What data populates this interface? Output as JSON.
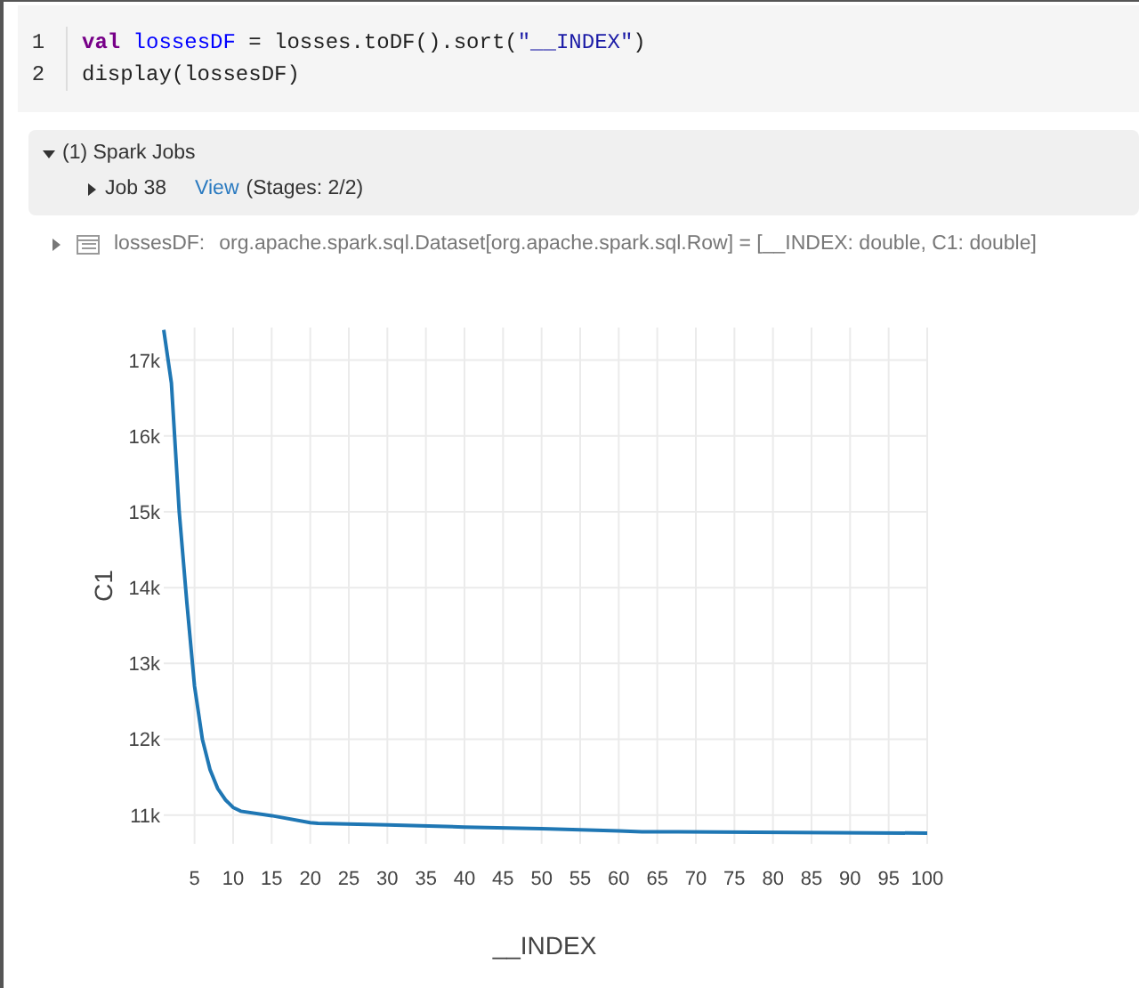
{
  "code_cell": {
    "lines": [
      {
        "number": "1",
        "tokens": [
          {
            "kind": "keyword",
            "text": "val"
          },
          {
            "kind": "variable",
            "text": " lossesDF"
          },
          {
            "kind": "plain",
            "text": " = losses.toDF().sort("
          },
          {
            "kind": "string",
            "text": "\"__INDEX\""
          },
          {
            "kind": "plain",
            "text": ")"
          }
        ]
      },
      {
        "number": "2",
        "tokens": [
          {
            "kind": "plain",
            "text": "display(lossesDF)"
          }
        ]
      }
    ]
  },
  "spark_jobs": {
    "title": "(1) Spark Jobs",
    "expanded": true,
    "jobs": [
      {
        "label": "Job 38",
        "expanded": false,
        "link": "View",
        "stages": "(Stages: 2/2)"
      }
    ]
  },
  "dataset": {
    "expanded": false,
    "name": "lossesDF:",
    "schema": "org.apache.spark.sql.Dataset[org.apache.spark.sql.Row] = [__INDEX: double, C1: double]"
  },
  "chart_data": {
    "type": "line",
    "xlabel": "__INDEX",
    "ylabel": "C1",
    "x": [
      1,
      2,
      3,
      4,
      5,
      6,
      7,
      8,
      9,
      10,
      11,
      15,
      20,
      21,
      30,
      40,
      50,
      60,
      63,
      100
    ],
    "series": [
      {
        "color": "#1f77b4",
        "values": [
          17400,
          16700,
          15000,
          13800,
          12700,
          12000,
          11600,
          11350,
          11200,
          11100,
          11050,
          10990,
          10900,
          10890,
          10870,
          10840,
          10820,
          10790,
          10780,
          10760
        ]
      }
    ],
    "grid": true,
    "xlim": [
      1,
      100
    ],
    "ylim": [
      10620,
      17430
    ],
    "xticks": [
      5,
      10,
      15,
      20,
      25,
      30,
      35,
      40,
      45,
      50,
      55,
      60,
      65,
      70,
      75,
      80,
      85,
      90,
      95,
      100
    ],
    "yticks": [
      {
        "value": 11000,
        "label": "11k"
      },
      {
        "value": 12000,
        "label": "12k"
      },
      {
        "value": 13000,
        "label": "13k"
      },
      {
        "value": 14000,
        "label": "14k"
      },
      {
        "value": 15000,
        "label": "15k"
      },
      {
        "value": 16000,
        "label": "16k"
      },
      {
        "value": 17000,
        "label": "17k"
      }
    ]
  }
}
